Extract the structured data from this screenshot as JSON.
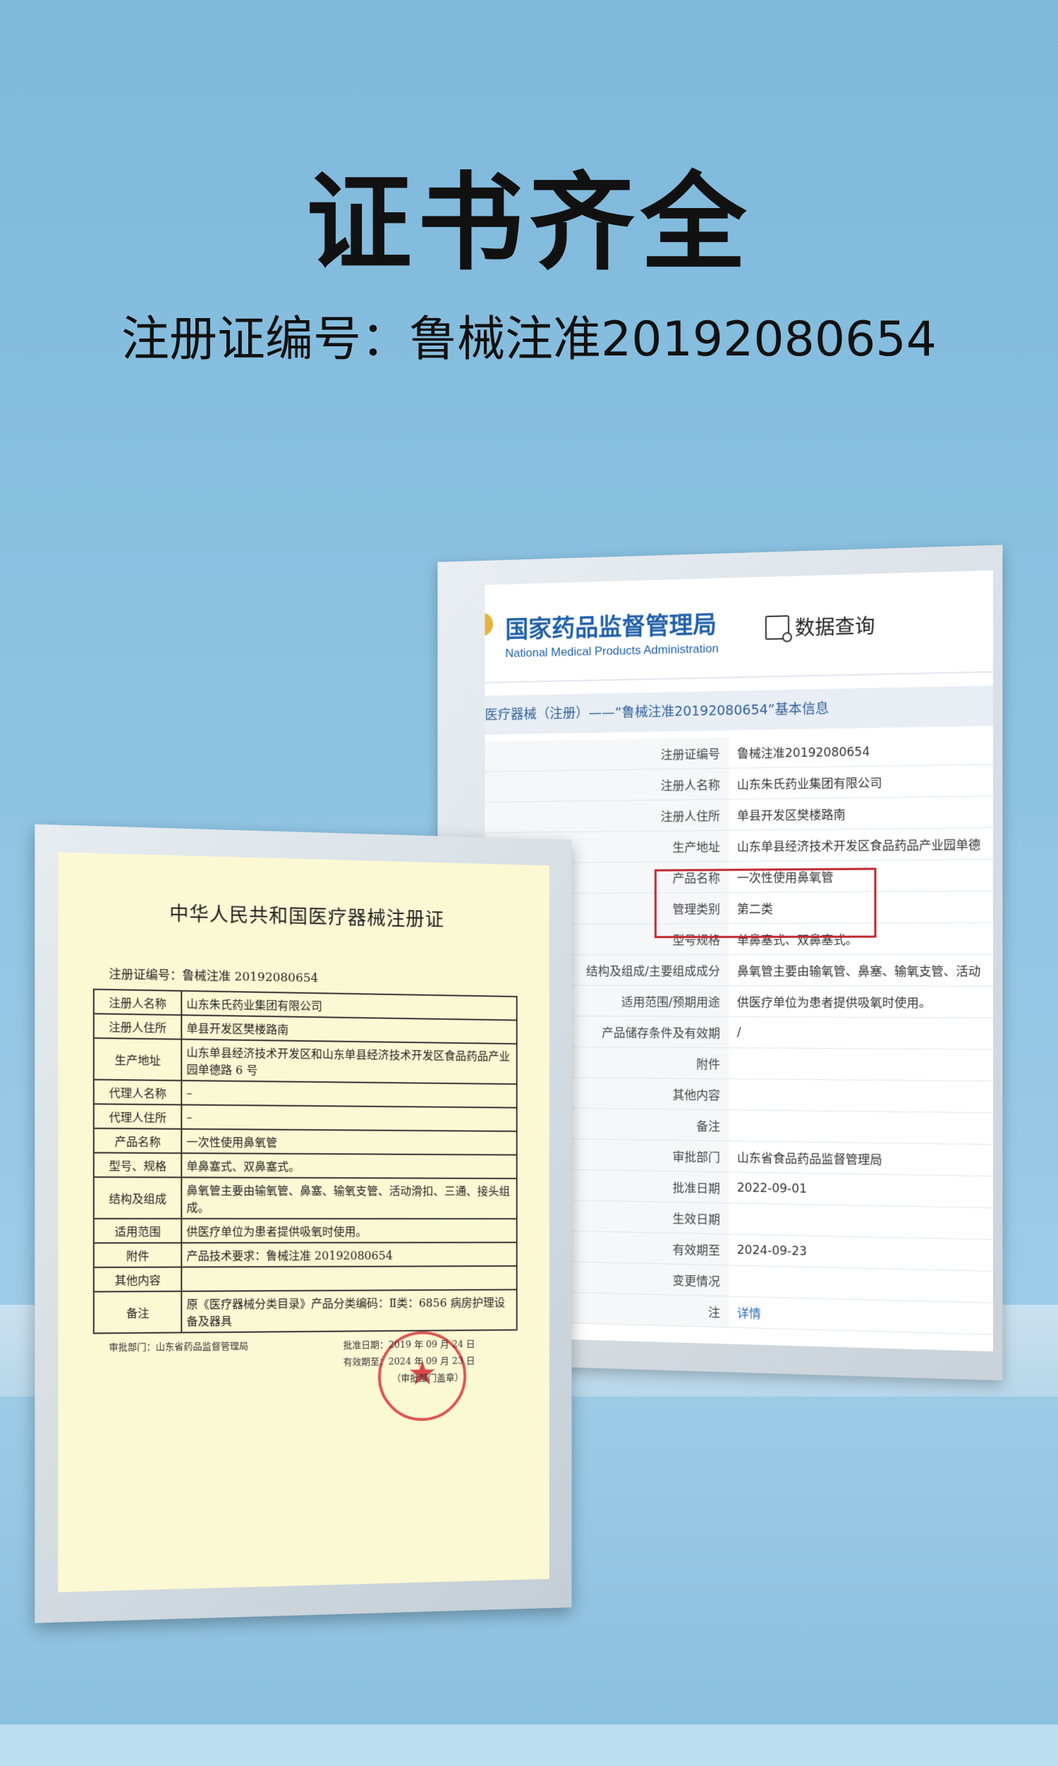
{
  "headline": "证书齐全",
  "registration_line": "注册证编号：鲁械注准20192080654",
  "database_screen": {
    "agency_name_cn": "国家药品监督管理局",
    "agency_name_en": "National Medical Products Administration",
    "query_label": "数据查询",
    "breadcrumb": "医疗器械（注册）——“鲁械注准20192080654”基本信息",
    "rows": [
      {
        "key": "注册证编号",
        "value": "鲁械注准20192080654"
      },
      {
        "key": "注册人名称",
        "value": "山东朱氏药业集团有限公司"
      },
      {
        "key": "注册人住所",
        "value": "单县开发区樊楼路南"
      },
      {
        "key": "生产地址",
        "value": "山东单县经济技术开发区食品药品产业园单德"
      },
      {
        "key": "产品名称",
        "value": "一次性使用鼻氧管"
      },
      {
        "key": "管理类别",
        "value": "第二类"
      },
      {
        "key": "型号规格",
        "value": "单鼻塞式、双鼻塞式。"
      },
      {
        "key": "结构及组成/主要组成成分",
        "value": "鼻氧管主要由输氧管、鼻塞、输氧支管、活动"
      },
      {
        "key": "适用范围/预期用途",
        "value": "供医疗单位为患者提供吸氧时使用。"
      },
      {
        "key": "产品储存条件及有效期",
        "value": "/"
      },
      {
        "key": "附件",
        "value": ""
      },
      {
        "key": "其他内容",
        "value": ""
      },
      {
        "key": "备注",
        "value": ""
      },
      {
        "key": "审批部门",
        "value": "山东省食品药品监督管理局"
      },
      {
        "key": "批准日期",
        "value": "2022-09-01"
      },
      {
        "key": "生效日期",
        "value": ""
      },
      {
        "key": "有效期至",
        "value": "2024-09-23"
      },
      {
        "key": "变更情况",
        "value": ""
      },
      {
        "key": "注",
        "value": "详情"
      }
    ]
  },
  "certificate": {
    "title": "中华人民共和国医疗器械注册证",
    "number_line": "注册证编号：鲁械注准 20192080654",
    "rows": [
      {
        "key": "注册人名称",
        "value": "山东朱氏药业集团有限公司"
      },
      {
        "key": "注册人住所",
        "value": "单县开发区樊楼路南"
      },
      {
        "key": "生产地址",
        "value": "山东单县经济技术开发区和山东单县经济技术开发区食品药品产业园单德路 6 号"
      },
      {
        "key": "代理人名称",
        "value": "–"
      },
      {
        "key": "代理人住所",
        "value": "–"
      },
      {
        "key": "产品名称",
        "value": "一次性使用鼻氧管"
      },
      {
        "key": "型号、规格",
        "value": "单鼻塞式、双鼻塞式。"
      },
      {
        "key": "结构及组成",
        "value": "鼻氧管主要由输氧管、鼻塞、输氧支管、活动滑扣、三通、接头组成。"
      },
      {
        "key": "适用范围",
        "value": "供医疗单位为患者提供吸氧时使用。"
      },
      {
        "key": "附件",
        "value": "产品技术要求：鲁械注准 20192080654"
      },
      {
        "key": "其他内容",
        "value": ""
      },
      {
        "key": "备注",
        "value": "原《医疗器械分类目录》产品分类编码：Ⅱ类：6856 病房护理设备及器具"
      }
    ],
    "authority": "审批部门：山东省药品监督管理局",
    "approval_date": "批准日期：2019 年 09 月 24 日",
    "expiry_date": "有效期至：2024 年 09 月 23 日",
    "seal_dept": "（审批部门盖章）"
  }
}
